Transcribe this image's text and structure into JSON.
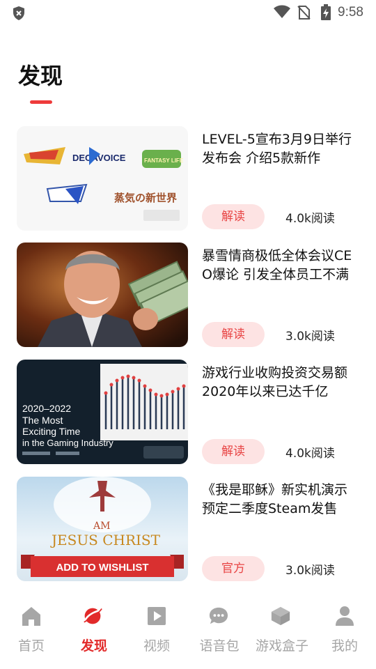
{
  "status_bar": {
    "time": "9:58"
  },
  "page": {
    "title": "发现"
  },
  "articles": [
    {
      "headline": "LEVEL-5宣布3月9日举行发布会 介绍5款新作",
      "tag": "解读",
      "reads": "4.0k阅读",
      "thumb_texts": [
        "DECA",
        "VOICE",
        "FANTASY LIFE",
        "蒸気の新世界"
      ]
    },
    {
      "headline": "暴雪情商极低全体会议CEO爆论 引发全体员工不满",
      "tag": "解读",
      "reads": "3.0k阅读"
    },
    {
      "headline": "游戏行业收购投资交易额2020年以来已达千亿",
      "tag": "解读",
      "reads": "4.0k阅读",
      "thumb_texts": [
        "2020–2022",
        "The Most",
        "Exciting Time",
        "in the Gaming Industry"
      ]
    },
    {
      "headline": "《我是耶稣》新实机演示 预定二季度Steam发售",
      "tag": "官方",
      "reads": "3.0k阅读",
      "thumb_texts": [
        "AM",
        "JESUS CHRIST",
        "ADD TO WISHLIST"
      ]
    }
  ],
  "nav": [
    {
      "label": "首页",
      "icon": "home-icon"
    },
    {
      "label": "发现",
      "icon": "planet-icon",
      "active": true
    },
    {
      "label": "视频",
      "icon": "video-icon"
    },
    {
      "label": "语音包",
      "icon": "chat-bubble-icon"
    },
    {
      "label": "游戏盒子",
      "icon": "cube-icon"
    },
    {
      "label": "我的",
      "icon": "user-icon"
    }
  ],
  "colors": {
    "accent": "#e22a2a",
    "tag_bg": "#fde3e3",
    "inactive": "#a6a6a6"
  }
}
